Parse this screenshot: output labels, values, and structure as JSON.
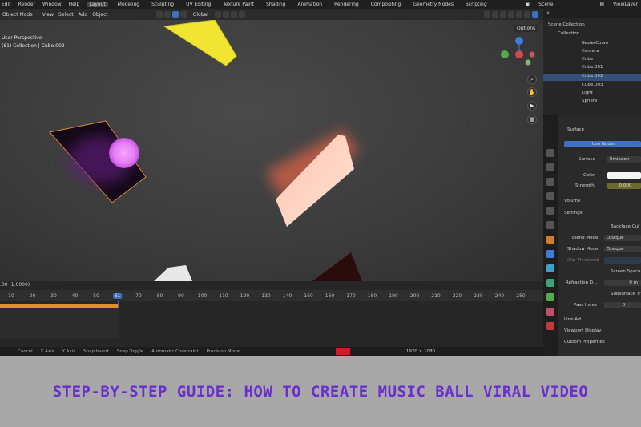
{
  "colors": {
    "accent": "#3d6fc2",
    "banner_bg": "#a8a8a8",
    "banner_text": "#6b2fd0",
    "timeline_orange": "#e0902a"
  },
  "menu": [
    "Edit",
    "Render",
    "Window",
    "Help"
  ],
  "workspaces": [
    {
      "label": "Layout",
      "active": true
    },
    {
      "label": "Modeling"
    },
    {
      "label": "Sculpting"
    },
    {
      "label": "UV Editing"
    },
    {
      "label": "Texture Paint"
    },
    {
      "label": "Shading"
    },
    {
      "label": "Animation"
    },
    {
      "label": "Rendering"
    },
    {
      "label": "Compositing"
    },
    {
      "label": "Geometry Nodes"
    },
    {
      "label": "Scripting"
    }
  ],
  "scene_label": "Scene",
  "view_layer_label": "ViewLayer",
  "viewport_header": {
    "mode": "Object Mode",
    "view": "View",
    "select": "Select",
    "add": "Add",
    "object": "Object",
    "transform": "Global",
    "options": "Options"
  },
  "viewport": {
    "perspective": "User Perspective",
    "collection_info": "(61) Collection | Cube.002",
    "axis_labels": {
      "x": "X",
      "y": "Y",
      "z": "Z"
    }
  },
  "timeline": {
    "frame_display": ".00 (1.0000)",
    "current_frame": "61",
    "ticks": [
      "10",
      "20",
      "30",
      "40",
      "50",
      "61",
      "70",
      "80",
      "90",
      "100",
      "110",
      "120",
      "130",
      "140",
      "150",
      "160",
      "170",
      "180",
      "190",
      "200",
      "210",
      "220",
      "230",
      "240",
      "250"
    ]
  },
  "statusbar": [
    "Cancel",
    "X Axis",
    "Y Axis",
    "Snap Invert",
    "Snap Toggle",
    "Automatic Constraint",
    "Precision Mode"
  ],
  "outliner": {
    "scene_collection": "Scene Collection",
    "collection": "Collection",
    "items": [
      {
        "label": "BezierCurve"
      },
      {
        "label": "Camera"
      },
      {
        "label": "Cube"
      },
      {
        "label": "Cube.001"
      },
      {
        "label": "Cube.002",
        "selected": true
      },
      {
        "label": "Cube.003"
      },
      {
        "label": "Light"
      },
      {
        "label": "Sphere"
      }
    ]
  },
  "properties": {
    "surface_header": "Surface",
    "use_nodes": "Use Nodes",
    "surface_label": "Surface",
    "surface_value": "Emission",
    "color_label": "Color",
    "strength_label": "Strength",
    "strength_value": "0.000",
    "volume": "Volume",
    "settings": "Settings",
    "backface": "Backface Cul",
    "blend_mode_label": "Blend Mode",
    "blend_mode_value": "Opaque",
    "shadow_mode_label": "Shadow Mode",
    "shadow_mode_value": "Opaque",
    "clip_label": "Clip Threshold",
    "screen_space": "Screen Space",
    "refraction_label": "Refraction D...",
    "refraction_value": "0 m",
    "subsurface": "Subsurface Tr",
    "pass_index_label": "Pass Index",
    "pass_index_value": "0",
    "line_art": "Line Art",
    "viewport_display": "Viewport Display",
    "custom_props": "Custom Properties"
  },
  "render_size": "1920 × 1080",
  "banner_title": "STEP-BY-STEP GUIDE: HOW TO CREATE MUSIC BALL VIRAL VIDEO"
}
